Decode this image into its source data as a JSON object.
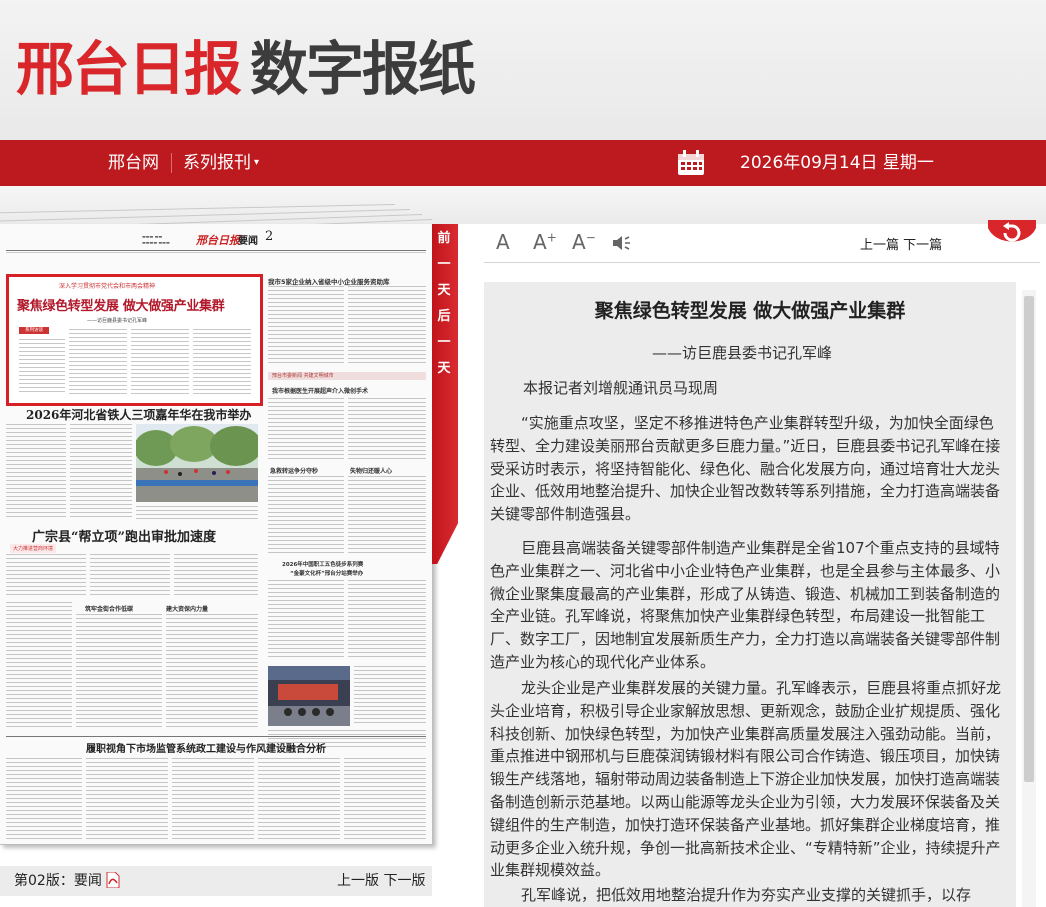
{
  "header": {
    "logo_red": "邢台日报",
    "logo_gray": "数字报纸"
  },
  "nav": {
    "site_link": "邢台网",
    "series_menu": "系列报刊",
    "date": "2026年09月14日  星期一"
  },
  "ribbon": {
    "label": "前一天后一天"
  },
  "newspaper": {
    "section_label": "要闻",
    "page_number": "2",
    "logo": "邢台日报",
    "lead_kicker": "深入学习贯彻市党代会和市两会精神",
    "lead_title": "聚焦绿色转型发展  做大做强产业集群",
    "lead_subtitle": "——访巨鹿县委书记孔军峰",
    "lead_tag": "系列访谈",
    "headline_2": "2026年河北省铁人三项嘉年华在我市举办",
    "headline_3": "广宗县“帮立项”跑出审批加速度",
    "headline_3_tag": "大力推进营商环境",
    "headline_4": "履职视角下市场监管系统政工建设与作风建设融合分析",
    "side_hl_1": "我市5家企业纳入省级中小企业服务资助库",
    "side_hl_2": "我市根据医生开展超声介入微创手术",
    "side_hl_3": "急救转运争分夺秒",
    "side_hl_4": "失物归还暖人心",
    "side_hl_5": "2026年中国职工五色徒步系列赛",
    "side_hl_6": "“金豪文化杯”邢台分站赛举办",
    "col_hl_1": "筑牢金街合作低碳",
    "col_hl_2": "建大资保内力量",
    "banner": "邢台市委新闻  共建文明城市"
  },
  "paper_footer": {
    "page_label": "第02版：要闻",
    "prev_page": "上一版",
    "next_page": "下一版"
  },
  "toolbar": {
    "font_normal": "A",
    "font_larger": "A",
    "font_smaller": "A",
    "larger_mark": "+",
    "smaller_mark": "−",
    "prev_article": "上一篇",
    "next_article": "下一篇"
  },
  "article": {
    "title": "聚焦绿色转型发展 做大做强产业集群",
    "subtitle": "——访巨鹿县委书记孔军峰",
    "byline": "本报记者刘增舰通讯员马现周",
    "paragraphs": [
      "“实施重点攻坚，坚定不移推进特色产业集群转型升级，为加快全面绿色转型、全力建设美丽邢台贡献更多巨鹿力量。”近日，巨鹿县委书记孔军峰在接受采访时表示，将坚持智能化、绿色化、融合化发展方向，通过培育壮大龙头企业、低效用地整治提升、加快企业智改数转等系列措施，全力打造高端装备关键零部件制造强县。",
      "巨鹿县高端装备关键零部件制造产业集群是全省107个重点支持的县域特色产业集群之一、河北省中小企业特色产业集群，也是全县参与主体最多、小微企业聚集度最高的产业集群，形成了从铸造、锻造、机械加工到装备制造的全产业链。孔军峰说，将聚焦加快产业集群绿色转型，布局建设一批智能工厂、数字工厂，因地制宜发展新质生产力，全力打造以高端装备关键零部件制造产业为核心的现代化产业体系。",
      "龙头企业是产业集群发展的关键力量。孔军峰表示，巨鹿县将重点抓好龙头企业培育，积极引导企业家解放思想、更新观念，鼓励企业扩规提质、强化科技创新、加快绿色转型，为加快产业集群高质量发展注入强劲动能。当前，重点推进中钢邢机与巨鹿葆润铸锻材料有限公司合作铸造、锻压项目，加快铸锻生产线落地，辐射带动周边装备制造上下游企业加快发展，加快打造高端装备制造创新示范基地。以两山能源等龙头企业为引领，大力发展环保装备及关键组件的生产制造，加快打造环保装备产业基地。抓好集群企业梯度培育，推动更多企业入统升规，争创一批高新技术企业、“专精特新”企业，持续提升产业集群规模效益。",
      "孔军峰说，把低效用地整治提升作为夯实产业支撑的关键抓手，以存"
    ]
  },
  "colors": {
    "brand_red": "#bd1a1f",
    "logo_red": "#d8262a",
    "article_bg": "#ececec"
  }
}
